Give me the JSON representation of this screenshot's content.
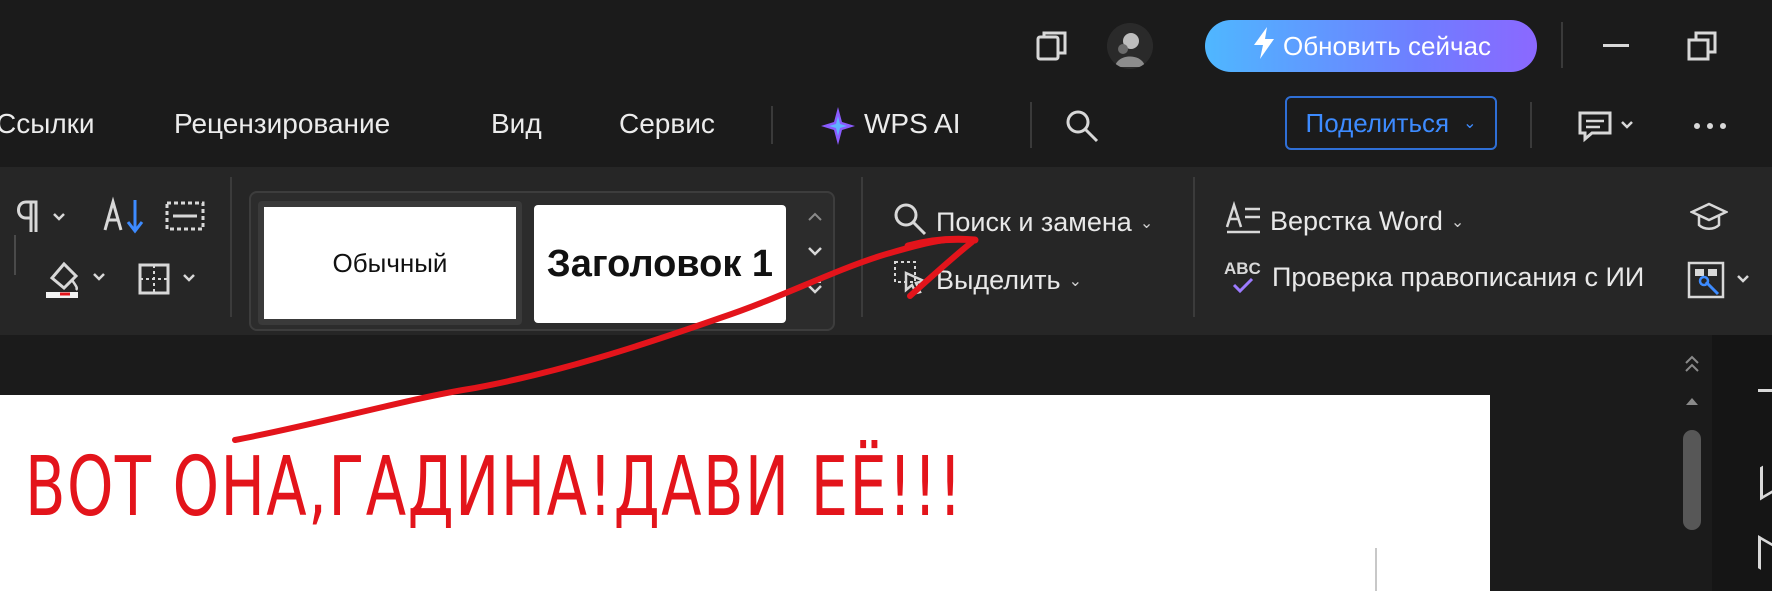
{
  "titlebar": {
    "update_label": "Обновить сейчас"
  },
  "menu": {
    "items": [
      "Ссылки",
      "Рецензирование",
      "Вид",
      "Сервис"
    ],
    "wps_ai": "WPS AI",
    "share_label": "Поделиться"
  },
  "ribbon": {
    "styles": [
      "Обычный",
      "Заголовок 1"
    ],
    "find_replace": "Поиск и замена",
    "select": "Выделить",
    "word_layout": "Верстка Word",
    "spellcheck": "Проверка правописания с ИИ",
    "abc_label": "ABC"
  },
  "annotation": {
    "text": "ВОТ ОНА,ГАДИНА!ДАВИ ЕЁ!!!",
    "color": "#e3141b"
  },
  "colors": {
    "background": "#1b1b1b",
    "ribbon": "#262626",
    "accent_blue": "#3d8bff",
    "update_gradient_start": "#4fb7ff",
    "update_gradient_end": "#8b68ff"
  }
}
